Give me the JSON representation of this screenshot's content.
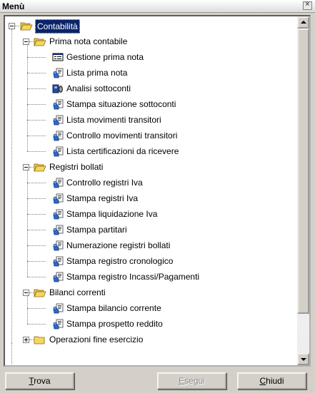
{
  "window": {
    "title": "Menù",
    "close_glyph": "×"
  },
  "tree": {
    "root": {
      "label": "Contabilità",
      "expanded": true,
      "selected": true
    },
    "groups": [
      {
        "label": "Prima nota contabile",
        "items": [
          {
            "label": "Gestione prima nota",
            "icon": "form-icon"
          },
          {
            "label": "Lista prima nota",
            "icon": "report-icon"
          },
          {
            "label": "Analisi sottoconti",
            "icon": "analysis-icon"
          },
          {
            "label": "Stampa situazione sottoconti",
            "icon": "report-icon"
          },
          {
            "label": "Lista movimenti transitori",
            "icon": "report-icon"
          },
          {
            "label": "Controllo movimenti transitori",
            "icon": "report-icon"
          },
          {
            "label": "Lista certificazioni da ricevere",
            "icon": "report-icon"
          }
        ]
      },
      {
        "label": "Registri bollati",
        "items": [
          {
            "label": "Controllo registri Iva",
            "icon": "report-icon"
          },
          {
            "label": "Stampa registri Iva",
            "icon": "report-icon"
          },
          {
            "label": "Stampa liquidazione Iva",
            "icon": "report-icon"
          },
          {
            "label": "Stampa partitari",
            "icon": "report-icon"
          },
          {
            "label": "Numerazione registri bollati",
            "icon": "report-icon"
          },
          {
            "label": "Stampa registro cronologico",
            "icon": "report-icon"
          },
          {
            "label": "Stampa registro Incassi/Pagamenti",
            "icon": "report-icon"
          }
        ]
      },
      {
        "label": "Bilanci correnti",
        "items": [
          {
            "label": "Stampa bilancio corrente",
            "icon": "report-icon"
          },
          {
            "label": "Stampa prospetto reddito",
            "icon": "report-icon"
          }
        ]
      },
      {
        "label": "Operazioni fine esercizio",
        "collapsed": true,
        "items": []
      }
    ]
  },
  "buttons": {
    "trova": {
      "first": "T",
      "rest": "rova",
      "enabled": true
    },
    "esegui": {
      "first": "E",
      "rest": "segui",
      "enabled": false
    },
    "chiudi": {
      "first": "C",
      "rest": "hiudi",
      "enabled": true
    }
  },
  "colors": {
    "selection": "#0a246a",
    "folder": "#f5d660",
    "background": "#d4d0c8"
  }
}
